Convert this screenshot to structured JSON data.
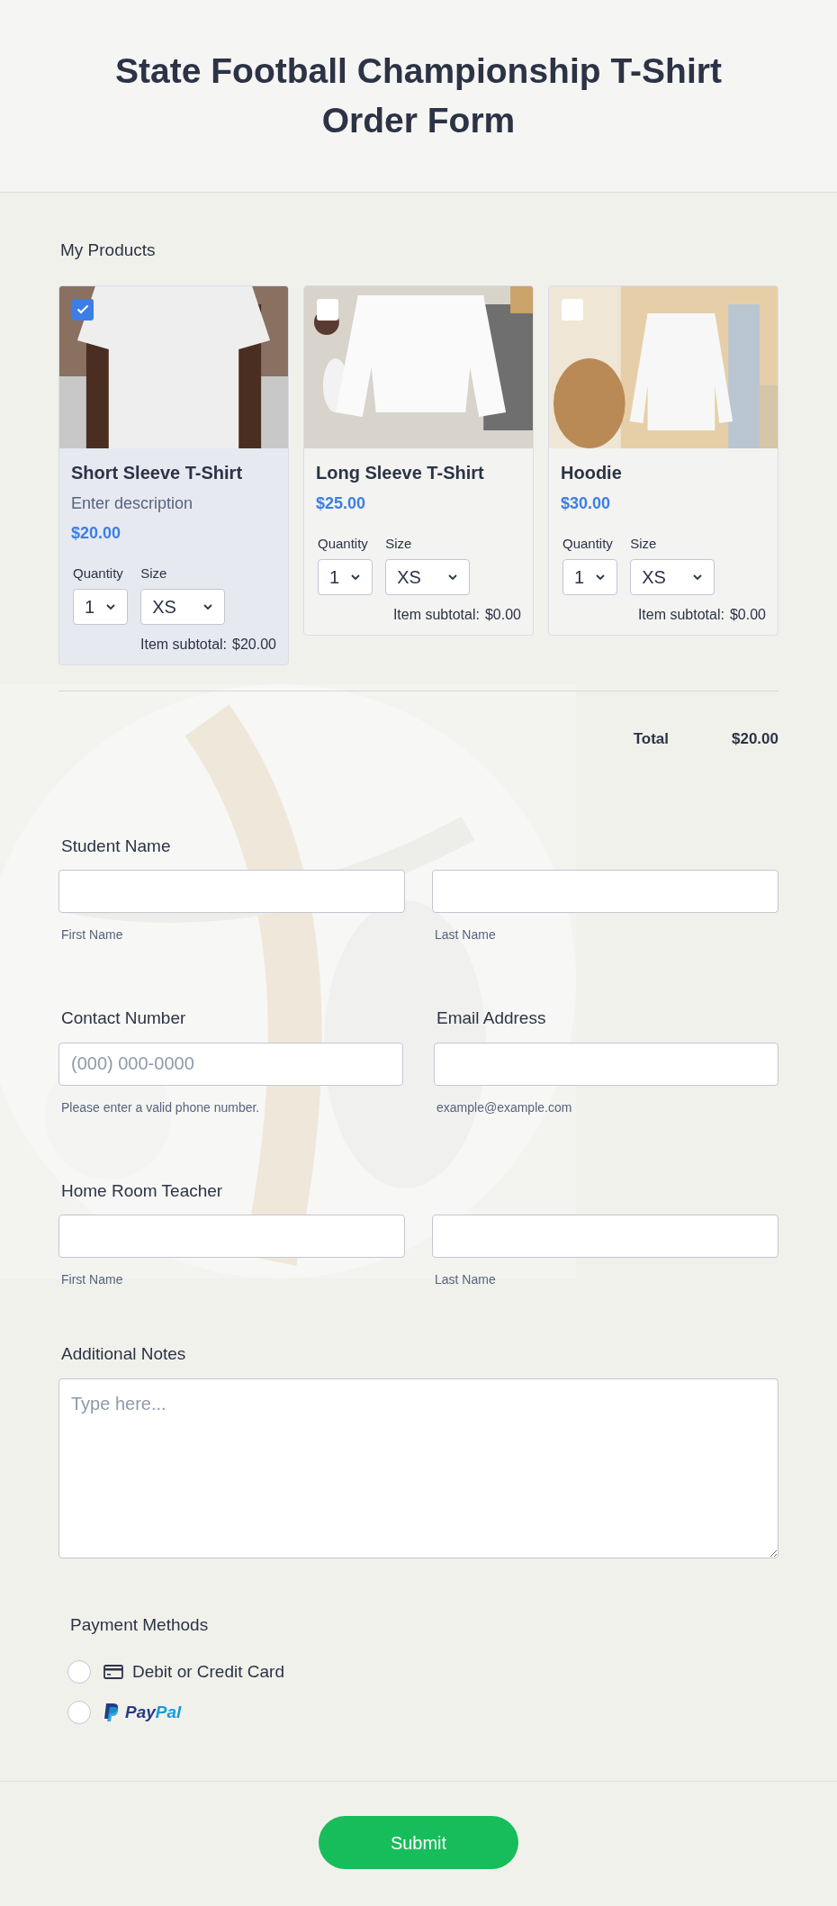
{
  "header": {
    "title": "State Football Championship T-Shirt Order Form"
  },
  "products": {
    "label": "My Products",
    "items": [
      {
        "kind": "picture",
        "name": "Short Sleeve T-Shirt",
        "description": "Enter description",
        "price": "$20.00",
        "quantity_label": "Quantity",
        "quantity": "1",
        "size_label": "Size",
        "size": "XS",
        "subtotal_label": "Item subtotal:",
        "subtotal": "$20.00",
        "selected": true
      },
      {
        "kind": "picture",
        "name": "Long Sleeve T-Shirt",
        "price": "$25.00",
        "quantity_label": "Quantity",
        "quantity": "1",
        "size_label": "Size",
        "size": "XS",
        "subtotal_label": "Item subtotal:",
        "subtotal": "$0.00",
        "selected": false
      },
      {
        "kind": "picture",
        "name": "Hoodie",
        "price": "$30.00",
        "quantity_label": "Quantity",
        "quantity": "1",
        "size_label": "Size",
        "size": "XS",
        "subtotal_label": "Item subtotal:",
        "subtotal": "$0.00",
        "selected": false
      }
    ],
    "total_label": "Total",
    "total": "$20.00"
  },
  "fields": [
    {
      "label": "Student Name",
      "inputs": [
        {
          "sublabel": "First Name"
        },
        {
          "sublabel": "Last Name"
        }
      ]
    },
    {
      "label": "Contact Number",
      "inputs": [
        {
          "placeholder": "(000) 000-0000",
          "sublabel": "Please enter a valid phone number."
        }
      ],
      "second_label": "Email Address",
      "second_inputs": [
        {
          "sublabel": "example@example.com"
        }
      ]
    },
    {
      "label": "Home Room Teacher",
      "inputs": [
        {
          "sublabel": "First Name"
        },
        {
          "sublabel": "Last Name"
        }
      ]
    }
  ],
  "notes": {
    "label": "Additional Notes",
    "placeholder": "Type here..."
  },
  "payment": {
    "label": "Payment Methods",
    "options": [
      {
        "kind": "card",
        "label": "Debit or Credit Card",
        "selected": false
      },
      {
        "kind": "paypal",
        "label_1": "Pay",
        "label_2": "Pal",
        "selected": false
      }
    ]
  },
  "submit": {
    "label": "Submit"
  }
}
